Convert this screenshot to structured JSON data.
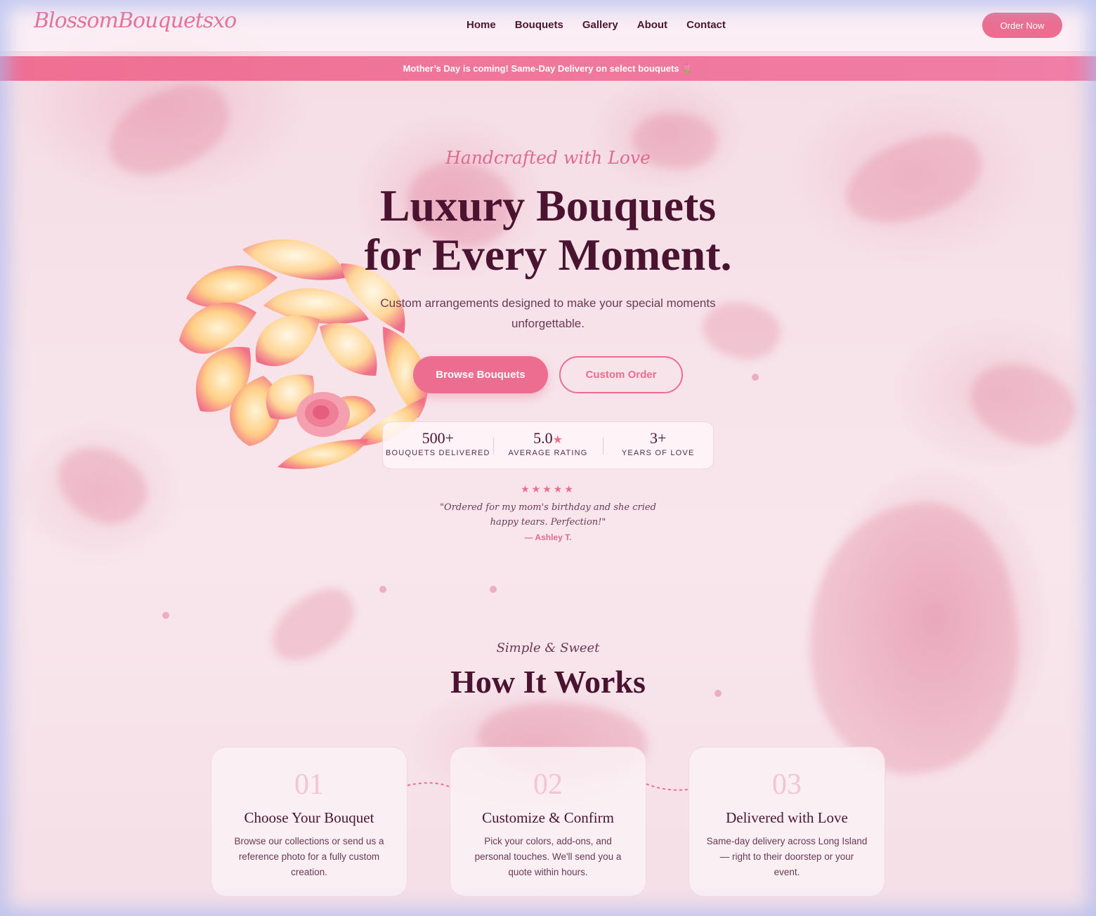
{
  "nav": {
    "logo": "BlossomBouquetsxo",
    "links": [
      "Home",
      "Bouquets",
      "Gallery",
      "About",
      "Contact"
    ],
    "cta": "Order Now"
  },
  "promo": {
    "text": "Mother’s Day is coming! Same-Day Delivery on select bouquets 🌷"
  },
  "hero": {
    "eyebrow": "Handcrafted with Love",
    "headline_line1": "Luxury Bouquets",
    "headline_line2": "for Every Moment.",
    "subtitle": "Custom arrangements designed to make your special moments unforgettable.",
    "primary_button": "Browse Bouquets",
    "secondary_button": "Custom Order",
    "stats": [
      {
        "value": "500+",
        "label": "BOUQUETS DELIVERED"
      },
      {
        "value": "5.0",
        "label": "AVERAGE RATING"
      },
      {
        "value": "3+",
        "label": "YEARS OF LOVE"
      }
    ],
    "review": {
      "stars": "★★★★★",
      "quote": "\"Ordered for my mom's birthday and she cried happy tears. Perfection!\"",
      "author": "— Ashley T."
    }
  },
  "how_it_works": {
    "eyebrow": "Simple & Sweet",
    "title": "How It Works",
    "steps": [
      {
        "number": "01",
        "title": "Choose Your Bouquet",
        "desc": "Browse our collections or send us a reference photo for a fully custom creation."
      },
      {
        "number": "02",
        "title": "Customize & Confirm",
        "desc": "Pick your colors, add-ons, and personal touches. We'll send you a quote within hours."
      },
      {
        "number": "03",
        "title": "Delivered with Love",
        "desc": "Same-day delivery across Long Island — right to their doorstep or your event."
      }
    ]
  },
  "colors": {
    "accent": "#ec6d90",
    "text": "#4a1430",
    "background": "#f7e4ea"
  }
}
